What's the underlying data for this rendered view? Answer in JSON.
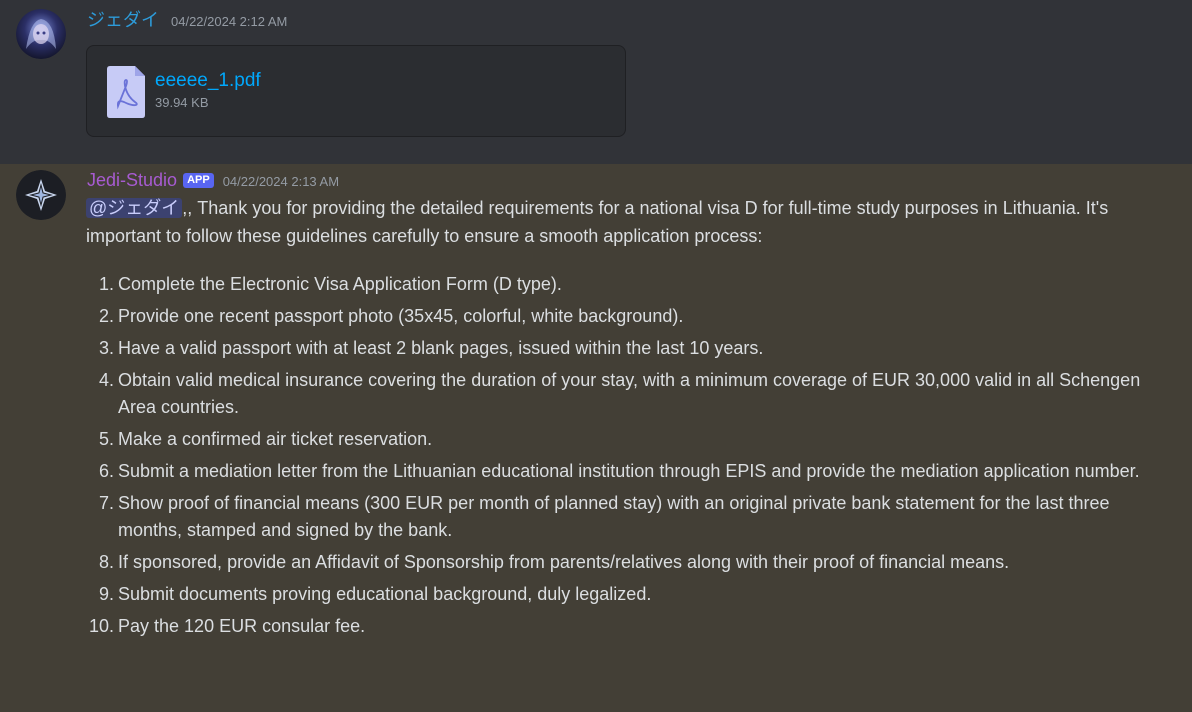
{
  "message1": {
    "username": "ジェダイ",
    "timestamp": "04/22/2024 2:12 AM",
    "attachment": {
      "file_name": "eeeee_1.pdf",
      "file_size": "39.94 KB",
      "icon": "pdf-file-icon"
    },
    "colors": {
      "username": "#2d9bd9",
      "link": "#00a8fc"
    }
  },
  "message2": {
    "username": "Jedi-Studio",
    "badge": "APP",
    "timestamp": "04/22/2024 2:13 AM",
    "mention": "@ジェダイ",
    "intro": ",, Thank you for providing the detailed requirements for a national visa D for full-time study purposes in Lithuania. It's important to follow these guidelines carefully to ensure a smooth application process:",
    "steps": [
      {
        "num": "1.",
        "text": "Complete the Electronic Visa Application Form (D type)."
      },
      {
        "num": "2.",
        "text": "Provide one recent passport photo (35x45, colorful, white background)."
      },
      {
        "num": "3.",
        "text": "Have a valid passport with at least 2 blank pages, issued within the last 10 years."
      },
      {
        "num": "4.",
        "text": "Obtain valid medical insurance covering the duration of your stay, with a minimum coverage of EUR 30,000 valid in all Schengen Area countries."
      },
      {
        "num": "5.",
        "text": "Make a confirmed air ticket reservation."
      },
      {
        "num": "6.",
        "text": "Submit a mediation letter from the Lithuanian educational institution through EPIS and provide the mediation application number."
      },
      {
        "num": "7.",
        "text": "Show proof of financial means (300 EUR per month of planned stay) with an original private bank statement for the last three months, stamped and signed by the bank."
      },
      {
        "num": "8.",
        "text": "If sponsored, provide an Affidavit of Sponsorship from parents/relatives along with their proof of financial means."
      },
      {
        "num": "9.",
        "text": "Submit documents proving educational background, duly legalized."
      },
      {
        "num": "10.",
        "text": "Pay the 120 EUR consular fee."
      }
    ],
    "colors": {
      "username": "#a75bd1",
      "badge": "#5865f2",
      "mention_bg": "#3c4270",
      "highlight_bg": "#433f36"
    }
  }
}
